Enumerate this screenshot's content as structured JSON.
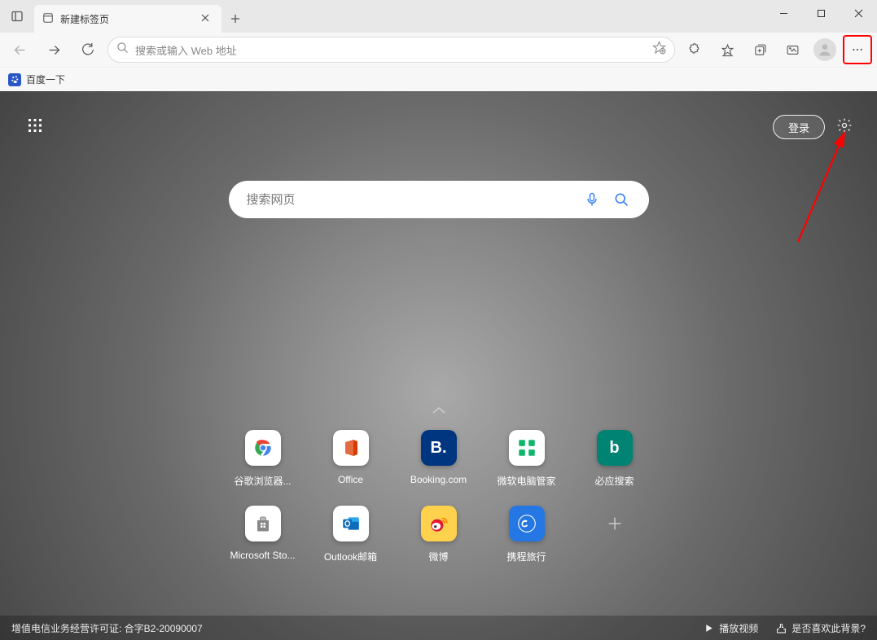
{
  "titlebar": {
    "tab_title": "新建标签页"
  },
  "toolbar": {
    "address_placeholder": "搜索或输入 Web 地址"
  },
  "bookmarks": {
    "items": [
      {
        "label": "百度一下"
      }
    ]
  },
  "ntp": {
    "login_label": "登录",
    "search_placeholder": "搜索网页",
    "tiles_row1": [
      {
        "label": "谷歌浏览器...",
        "bg": "#ffffff",
        "fg": "#4285f4",
        "icon_text": "",
        "icon_name": "chrome-icon"
      },
      {
        "label": "Office",
        "bg": "#ffffff",
        "fg": "#d83b01",
        "icon_text": "",
        "icon_name": "office-icon"
      },
      {
        "label": "Booking.com",
        "bg": "#003580",
        "fg": "#ffffff",
        "icon_text": "B.",
        "icon_name": "booking-icon"
      },
      {
        "label": "微软电脑管家",
        "bg": "#ffffff",
        "fg": "#0fb56d",
        "icon_text": "",
        "icon_name": "pc-manager-icon"
      },
      {
        "label": "必应搜索",
        "bg": "#008373",
        "fg": "#ffffff",
        "icon_text": "b",
        "icon_name": "bing-icon"
      }
    ],
    "tiles_row2": [
      {
        "label": "Microsoft Sto...",
        "bg": "#ffffff",
        "fg": "#555",
        "icon_text": "",
        "icon_name": "ms-store-icon"
      },
      {
        "label": "Outlook邮箱",
        "bg": "#ffffff",
        "fg": "#0f6cbd",
        "icon_text": "",
        "icon_name": "outlook-icon"
      },
      {
        "label": "微博",
        "bg": "#ffd24d",
        "fg": "#e6162d",
        "icon_text": "",
        "icon_name": "weibo-icon"
      },
      {
        "label": "携程旅行",
        "bg": "#2577e3",
        "fg": "#ffffff",
        "icon_text": "",
        "icon_name": "ctrip-icon"
      }
    ]
  },
  "footer": {
    "license_text": "增值电信业务经营许可证: 合字B2-20090007",
    "play_video": "播放视频",
    "like_bg": "是否喜欢此背景?"
  }
}
